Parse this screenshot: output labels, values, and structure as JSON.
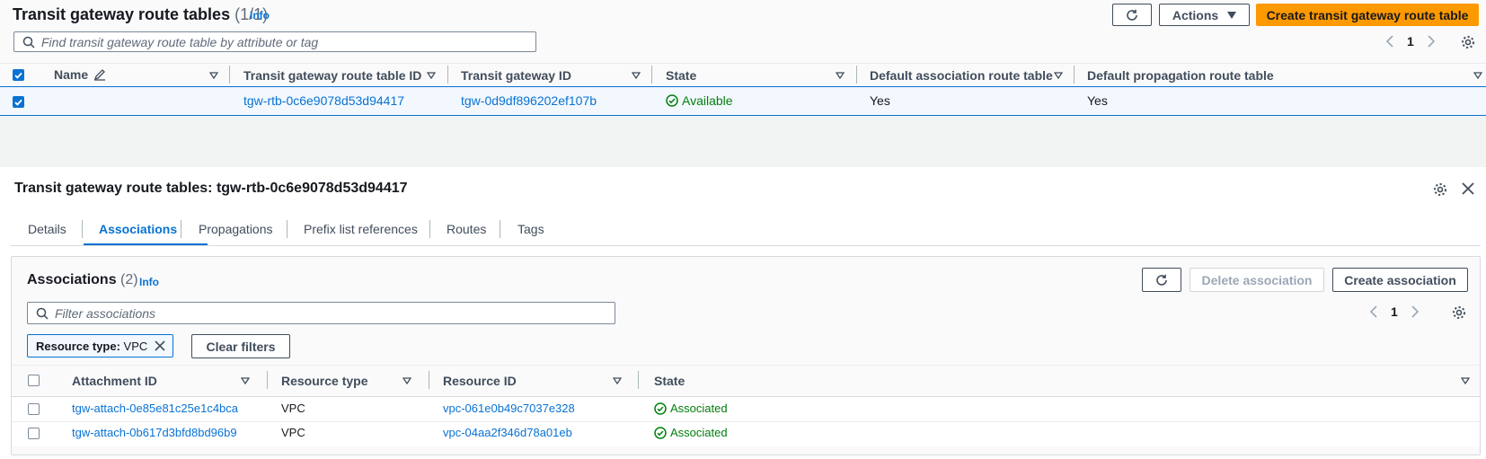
{
  "top_table": {
    "title": "Transit gateway route tables",
    "count": "(1/1)",
    "info": "Info",
    "actions_label": "Actions",
    "create_label": "Create transit gateway route table",
    "search_placeholder": "Find transit gateway route table by attribute or tag",
    "page": "1",
    "columns": [
      "Name",
      "Transit gateway route table ID",
      "Transit gateway ID",
      "State",
      "Default association route table",
      "Default propagation route table"
    ],
    "rows": [
      {
        "name": "",
        "route_table_id": "tgw-rtb-0c6e9078d53d94417",
        "tgw_id": "tgw-0d9df896202ef107b",
        "state": "Available",
        "default_association": "Yes",
        "default_propagation": "Yes",
        "selected": true
      }
    ]
  },
  "detail": {
    "title": "Transit gateway route tables: tgw-rtb-0c6e9078d53d94417",
    "tabs": [
      "Details",
      "Associations",
      "Propagations",
      "Prefix list references",
      "Routes",
      "Tags"
    ],
    "active_tab": "Associations"
  },
  "associations": {
    "title": "Associations",
    "count": "(2)",
    "info": "Info",
    "delete_label": "Delete association",
    "create_label": "Create association",
    "search_placeholder": "Filter associations",
    "page": "1",
    "filter_token": {
      "key": "Resource type:",
      "value": "VPC"
    },
    "clear_filters_label": "Clear filters",
    "columns": [
      "Attachment ID",
      "Resource type",
      "Resource ID",
      "State"
    ],
    "rows": [
      {
        "attachment_id": "tgw-attach-0e85e81c25e1c4bca",
        "resource_type": "VPC",
        "resource_id": "vpc-061e0b49c7037e328",
        "state": "Associated"
      },
      {
        "attachment_id": "tgw-attach-0b617d3bfd8bd96b9",
        "resource_type": "VPC",
        "resource_id": "vpc-04aa2f346d78a01eb",
        "state": "Associated"
      }
    ]
  },
  "colors": {
    "primary_orange": "#ff9900",
    "link_blue": "#0972d3",
    "success_green": "#037f0c",
    "selected_row_bg": "#f2f8fd"
  }
}
